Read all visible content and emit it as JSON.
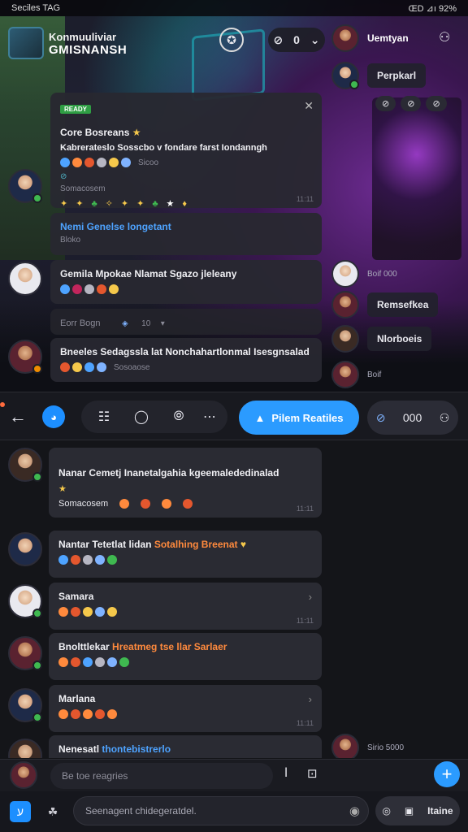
{
  "status_bar": {
    "left": "Seciles TAG",
    "right": "ŒD ⊿ı 92%"
  },
  "game": {
    "title_line1": "Konmuuliviar",
    "title_line2": "GMISNANSH",
    "emblem": "✪"
  },
  "counter": {
    "icon": "⊘",
    "value": "0"
  },
  "sidebar": {
    "top_user": "Uemtyan",
    "top_user_status": "Perpkarl",
    "mini_pills": [
      "⊘",
      "⊘",
      "⊘"
    ],
    "online": [
      {
        "name": "Boif 000",
        "style": "small"
      },
      {
        "name": "Remsefkea",
        "style": "pill"
      },
      {
        "name": "Nlorboeis",
        "style": "pill"
      },
      {
        "name": "Boif",
        "style": "small"
      }
    ]
  },
  "hero_cards": [
    {
      "tag": "READY",
      "title": "Core Bosreans",
      "subtitle": "Kabrerateslo Sosscbo v fondare farst Iondanngh",
      "meta": "Sicoo",
      "badge": "⊘",
      "footer": "Somacosem",
      "time": "11:11"
    },
    {
      "title": "Nemi Genelse longetant",
      "meta": "Bloko"
    },
    {
      "title": "Gemila Mpokae Nlamat Sgazo jleleany"
    },
    {
      "title": "Eorr Bogn",
      "count": "10"
    },
    {
      "title": "Bneeles Sedagssla lat Nonchahartlonmal Isesgnsalad",
      "meta": "Sosoaose"
    }
  ],
  "toolbar": {
    "back": "←",
    "icons": [
      "☷",
      "◯",
      "⦾",
      "⋯"
    ],
    "primary_label": "Pilem Reatiles",
    "secondary_label": "000"
  },
  "messages": [
    {
      "title": "Nanar Cemetj Inanetalgahia kgeemalededinalad",
      "meta": "Somacosem",
      "time": "11:11"
    },
    {
      "title_a": "Nantar Tetetlat lidan",
      "title_b": "Sotalhing Breenat"
    },
    {
      "title": "Samara",
      "time": "11:11"
    },
    {
      "title_a": "Bnolttlekar",
      "title_b": "Hreatmeg tse llar Sarlaer"
    },
    {
      "title": "Marlana",
      "time": "11:11"
    },
    {
      "title_a": "Nenesatl",
      "title_b": "thontebistrerlo",
      "side": "Sirio 5000"
    }
  ],
  "composer": {
    "reply_placeholder": "Be toe reagries",
    "message_placeholder": "Seenagent chidegeratdel.",
    "send_label": "Itaine"
  },
  "colors": {
    "accent": "#2b9bff",
    "online": "#3fb950",
    "highlight_orange": "#ff8a3d",
    "highlight_yellow": "#f5c84b"
  }
}
